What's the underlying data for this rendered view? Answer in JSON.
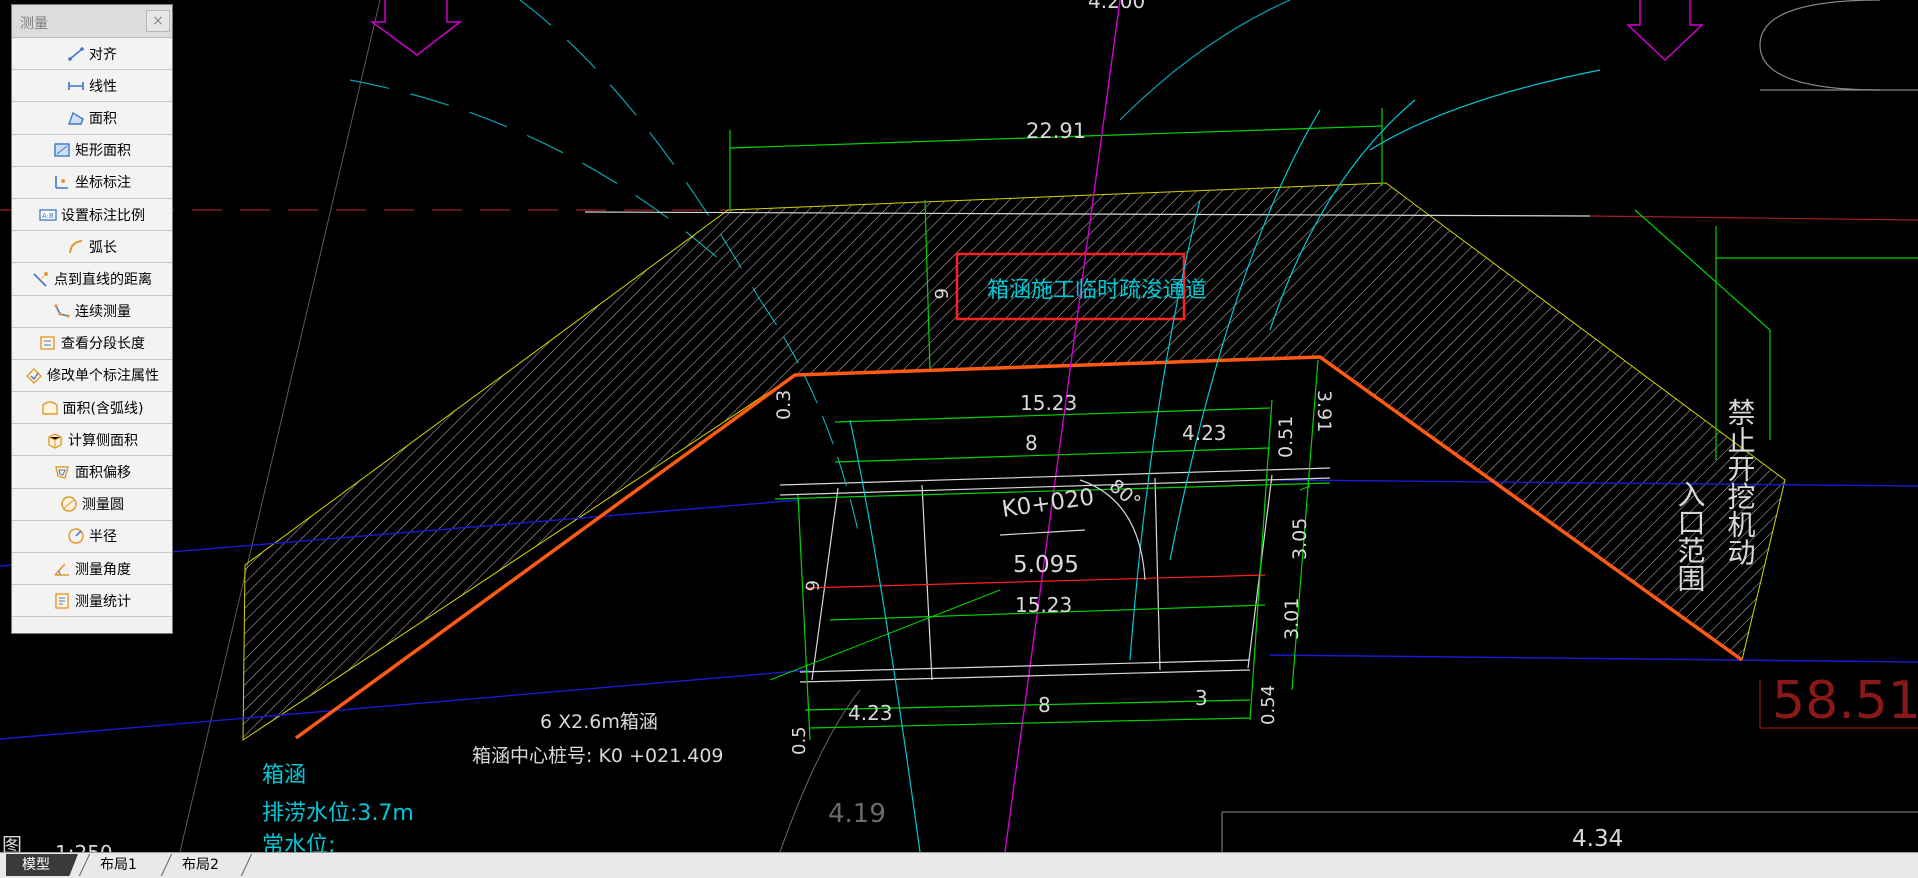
{
  "panel": {
    "title": "测量",
    "close_label": "×",
    "items": [
      {
        "label": "对齐",
        "icon": "align-measure-icon"
      },
      {
        "label": "线性",
        "icon": "linear-measure-icon"
      },
      {
        "label": "面积",
        "icon": "area-icon"
      },
      {
        "label": "矩形面积",
        "icon": "rect-area-icon"
      },
      {
        "label": "坐标标注",
        "icon": "coordinate-icon"
      },
      {
        "label": "设置标注比例",
        "icon": "scale-icon"
      },
      {
        "label": "弧长",
        "icon": "arc-length-icon"
      },
      {
        "label": "点到直线的距离",
        "icon": "point-line-distance-icon"
      },
      {
        "label": "连续测量",
        "icon": "continuous-measure-icon"
      },
      {
        "label": "查看分段长度",
        "icon": "segment-length-icon"
      },
      {
        "label": "修改单个标注属性",
        "icon": "edit-annotation-icon"
      },
      {
        "label": "面积(含弧线)",
        "icon": "arc-area-icon"
      },
      {
        "label": "计算侧面积",
        "icon": "side-area-icon"
      },
      {
        "label": "面积偏移",
        "icon": "area-offset-icon"
      },
      {
        "label": "测量圆",
        "icon": "circle-measure-icon"
      },
      {
        "label": "半径",
        "icon": "radius-icon"
      },
      {
        "label": "测量角度",
        "icon": "angle-icon"
      },
      {
        "label": "测量统计",
        "icon": "statistics-icon"
      }
    ]
  },
  "tabs": [
    {
      "label": "模型",
      "active": true
    },
    {
      "label": "布局1",
      "active": false
    },
    {
      "label": "布局2",
      "active": false
    }
  ],
  "drawing": {
    "dim_top": "22.91",
    "dim_left_slope": "6",
    "callout": "箱涵施工临时疏浚通道",
    "dim_15_23_top": "15.23",
    "dim_8_top": "8",
    "dim_4_23_top": "4.23",
    "dim_3_91": "3.91",
    "dim_0_51": "0.51",
    "dim_0_3": "0.3",
    "angle": "80°",
    "station": "K0+020",
    "station_value": "5.095",
    "dim_15_23_mid": "15.23",
    "dim_3_05": "3.05",
    "dim_3_01": "3.01",
    "dim_6": "6",
    "dim_4_23_bot": "4.23",
    "dim_8_bot": "8",
    "dim_3_bot": "3",
    "dim_0_54": "0.54",
    "dim_0_5": "0.5",
    "culvert_size": "6 X2.6m箱涵",
    "culvert_center": "箱涵中心桩号: K0 +021.409",
    "culvert_label": "箱涵",
    "drain_level": "排涝水位:3.7m",
    "normal_level": "常水位:",
    "elev_4_19": "4.19",
    "elev_4_34": "4.34",
    "elev_4_200": "4.200",
    "big_value": "58.51",
    "right_vertical_1": "禁止开挖机动",
    "right_vertical_2": "入口范围",
    "left_bottom_mark": "图",
    "left_bottom_scale": "1:250",
    "colors": {
      "orange": "#ff5a14",
      "yellow": "#d8d400",
      "cyan": "#00c8d8",
      "green": "#00d400",
      "blue": "#1010c8",
      "magenta": "#d000d0",
      "red": "#ff2020",
      "white": "#e8e8e8",
      "darkred": "#8a1818"
    }
  }
}
